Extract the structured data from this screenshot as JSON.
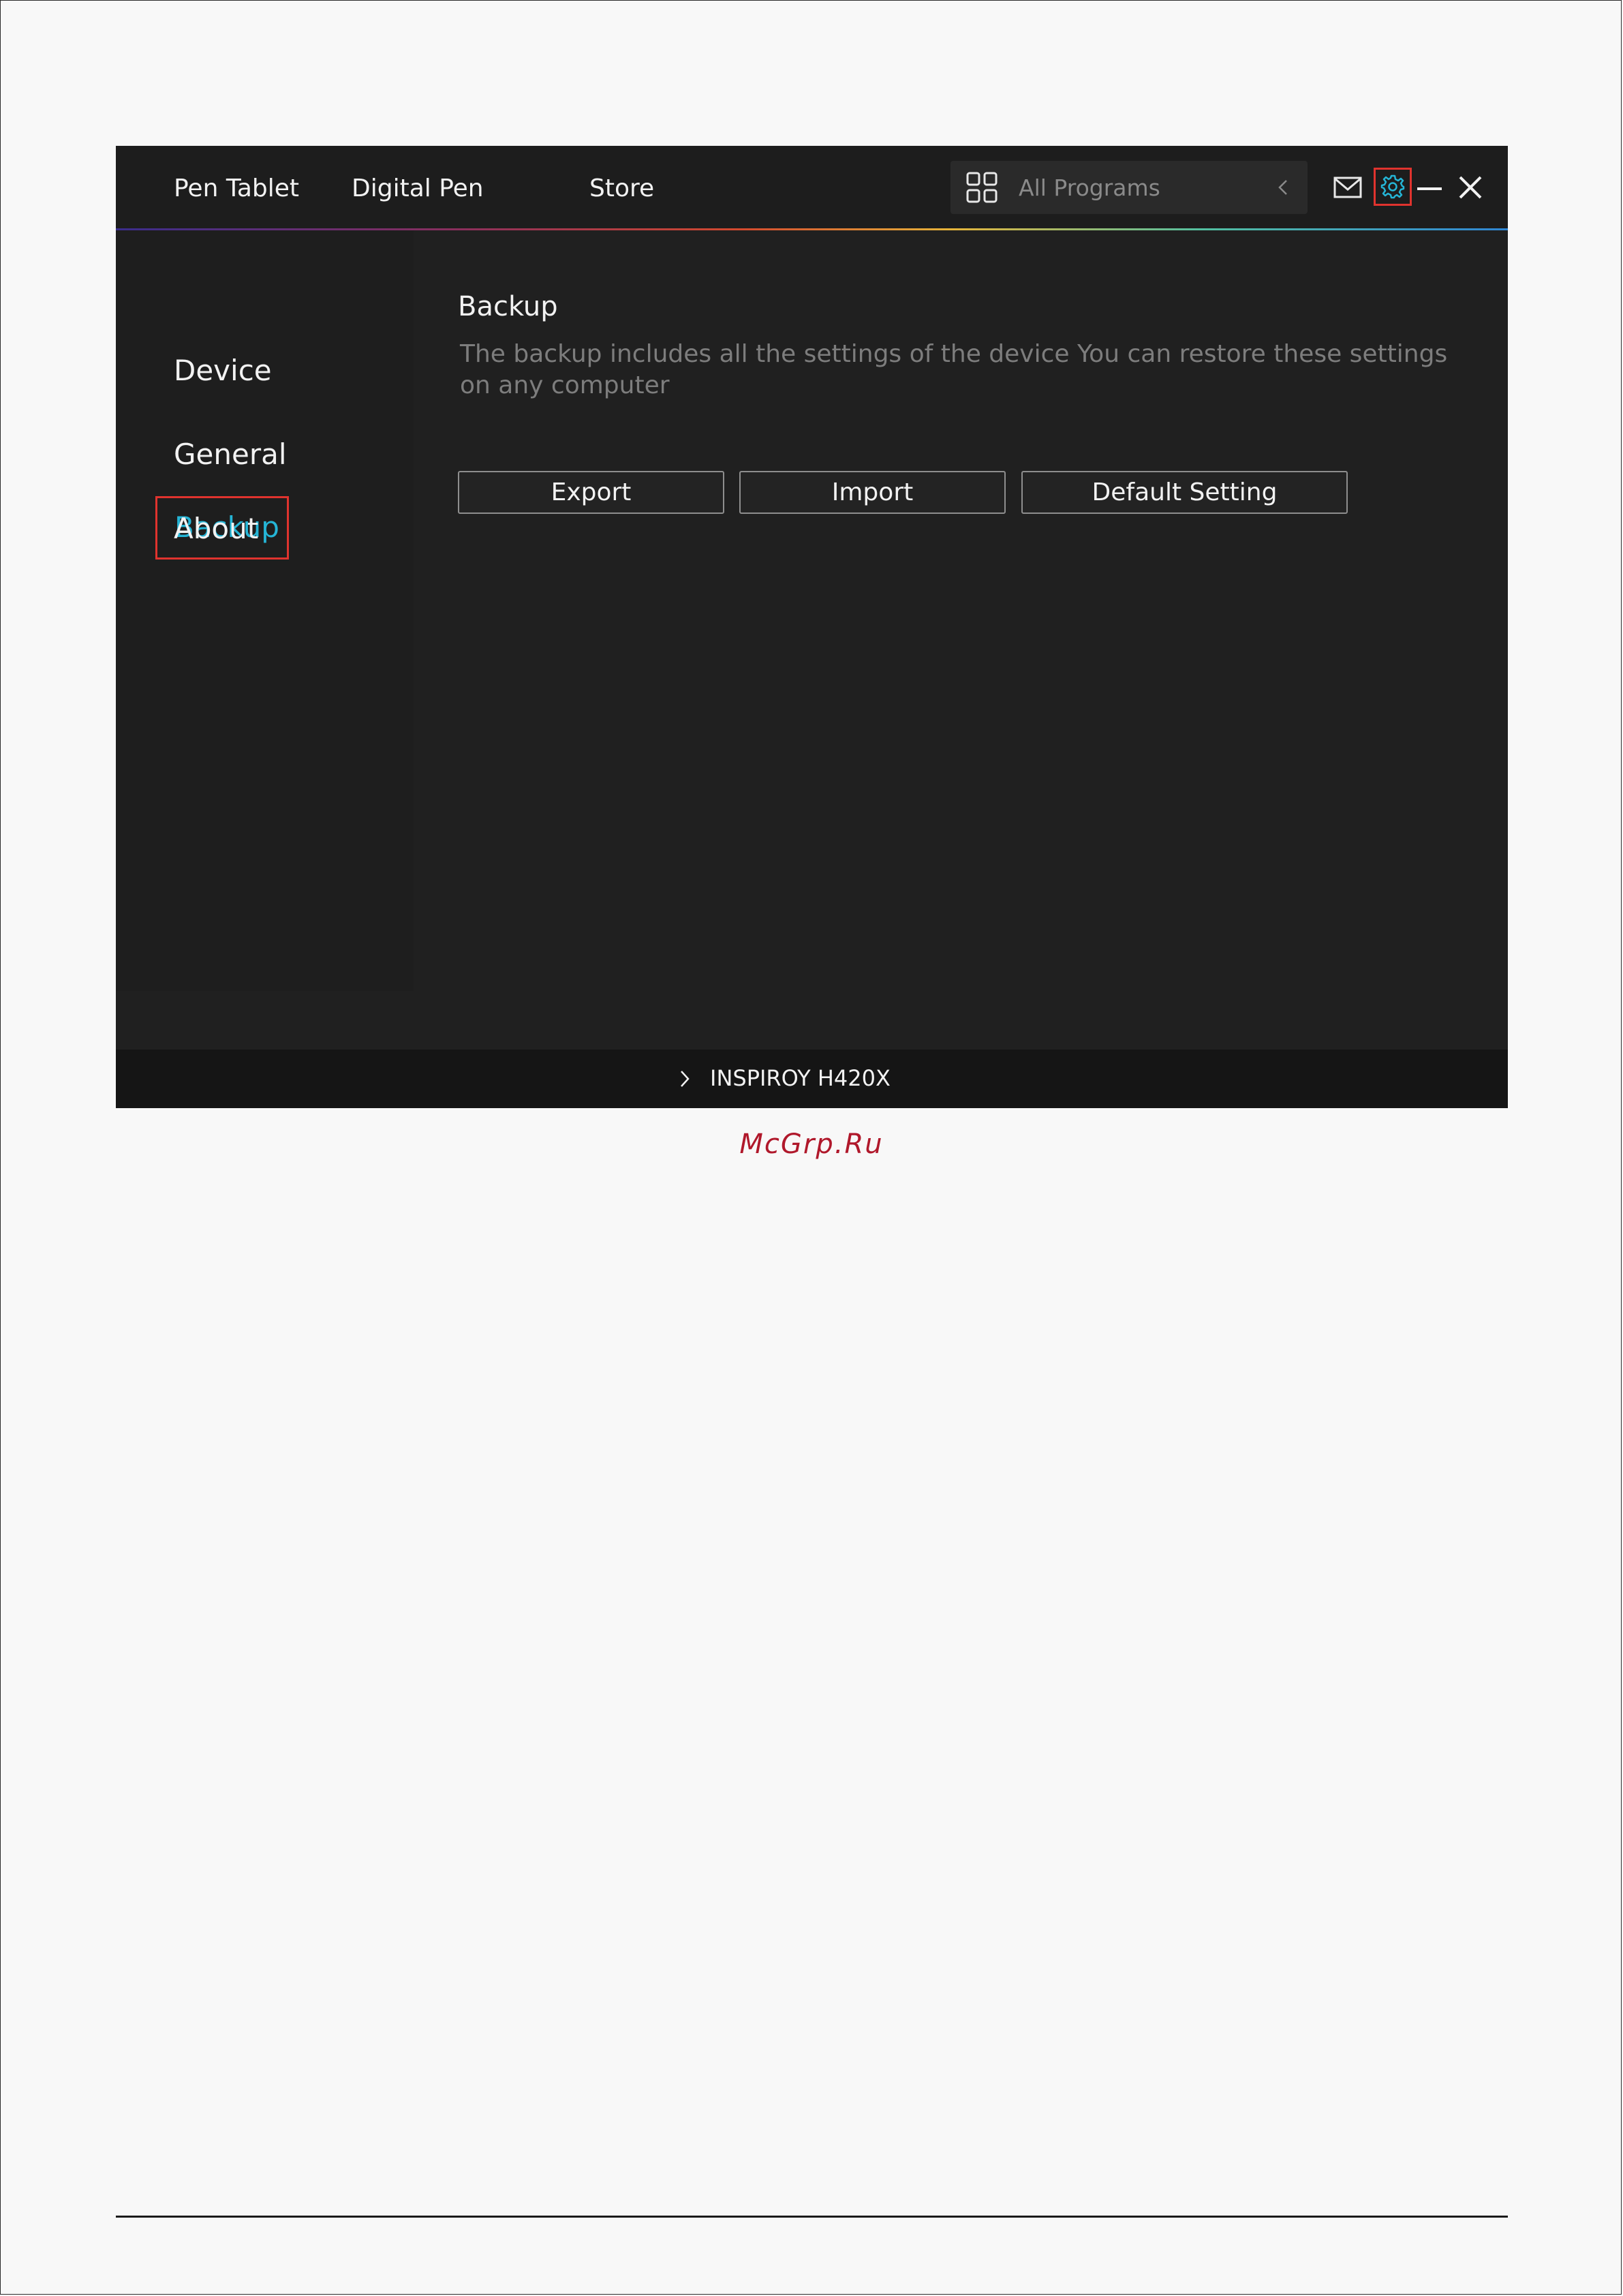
{
  "topbar": {
    "tabs": [
      {
        "label": "Pen Tablet"
      },
      {
        "label": "Digital Pen"
      },
      {
        "label": "Store"
      }
    ],
    "program_selector": {
      "label": "All Programs",
      "icon": "grid-icon",
      "chevron": "chevron-left-icon"
    },
    "icons": [
      "mail-icon",
      "gear-icon",
      "minimize-icon",
      "close-icon"
    ]
  },
  "sidebar": {
    "items": [
      {
        "label": "Device"
      },
      {
        "label": "Backup",
        "active": true
      },
      {
        "label": "General"
      },
      {
        "label": "About"
      }
    ]
  },
  "main": {
    "title": "Backup",
    "description": "The backup includes all the settings of the device You can restore these settings  on any computer",
    "buttons": {
      "export": "Export",
      "import": "Import",
      "default": "Default Setting"
    }
  },
  "device_bar": {
    "device_name": "INSPIROY H420X"
  },
  "watermark": "McGrp.Ru",
  "colors": {
    "accent": "#25b5d6",
    "highlight_box": "#e0332e",
    "background": "#202020"
  }
}
